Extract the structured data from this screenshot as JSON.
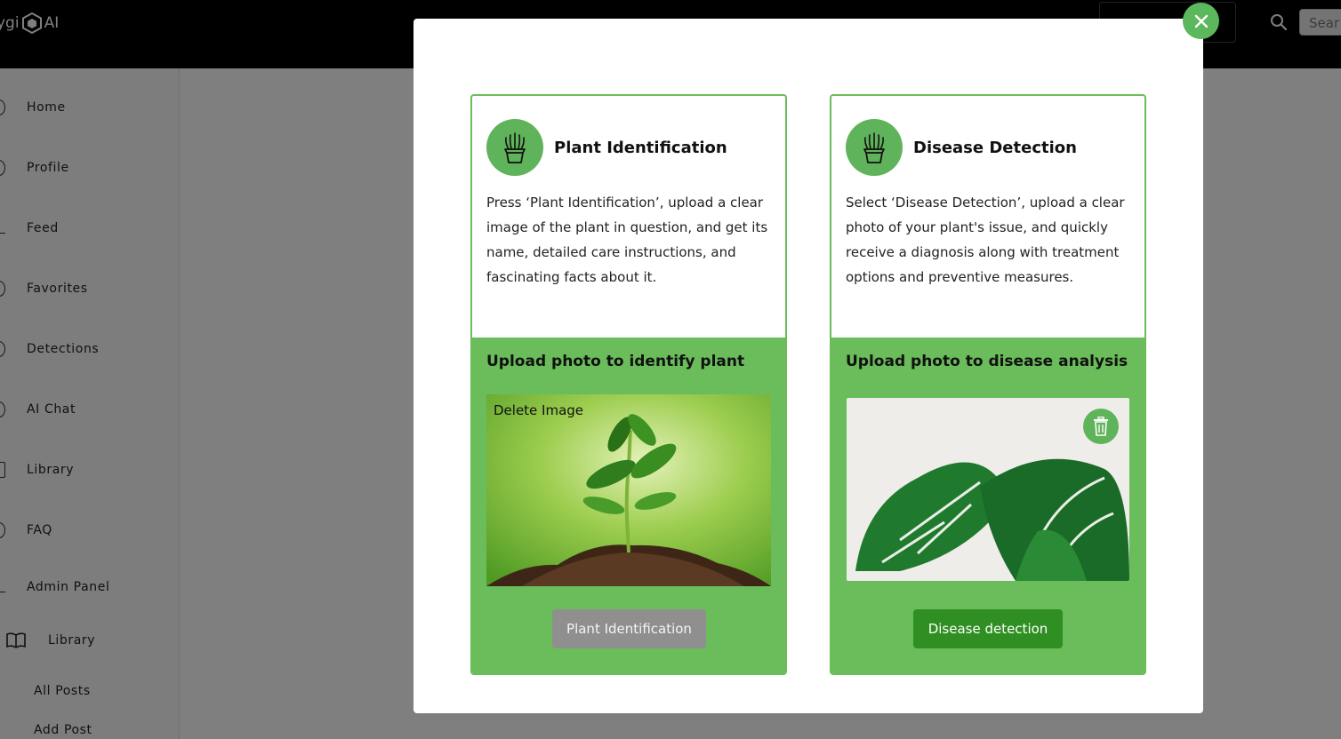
{
  "app": {
    "logo_text_left": "ygi",
    "logo_text_right": "AI",
    "top_button_label": "",
    "search_placeholder": "Sear"
  },
  "sidebar": {
    "items": [
      {
        "label": "Home"
      },
      {
        "label": "Profile"
      },
      {
        "label": "Feed"
      },
      {
        "label": "Favorites"
      },
      {
        "label": "Detections"
      },
      {
        "label": "AI Chat"
      },
      {
        "label": "Library"
      },
      {
        "label": "FAQ"
      },
      {
        "label": "Admin Panel"
      }
    ],
    "admin_library_label": "Library",
    "sub_items": [
      {
        "label": "All Posts"
      },
      {
        "label": "Add Post"
      }
    ]
  },
  "modal": {
    "cards": [
      {
        "title": "Plant Identification",
        "description": "Press ‘Plant Identification’, upload a clear image of the plant in question, and get its name, detailed care instructions, and fascinating facts about it.",
        "upload_title": "Upload photo to identify plant",
        "delete_label": "Delete Image",
        "button_label": "Plant Identification"
      },
      {
        "title": "Disease Detection",
        "description": "Select ‘Disease Detection’, upload a clear photo of your plant's issue, and quickly receive a diagnosis along with treatment options and preventive measures.",
        "upload_title": "Upload photo to disease analysis",
        "button_label": "Disease detection"
      }
    ]
  },
  "colors": {
    "accent": "#6abd5a",
    "icon_bg": "#5fb35a",
    "close_button": "#5cb85c",
    "button_green": "#2f8f22",
    "button_grey": "#8f8f8f",
    "topbar": "#000000"
  },
  "icons": [
    "hexagon-logo-icon",
    "search-icon",
    "close-icon",
    "potted-plant-icon",
    "trash-icon",
    "book-icon"
  ]
}
